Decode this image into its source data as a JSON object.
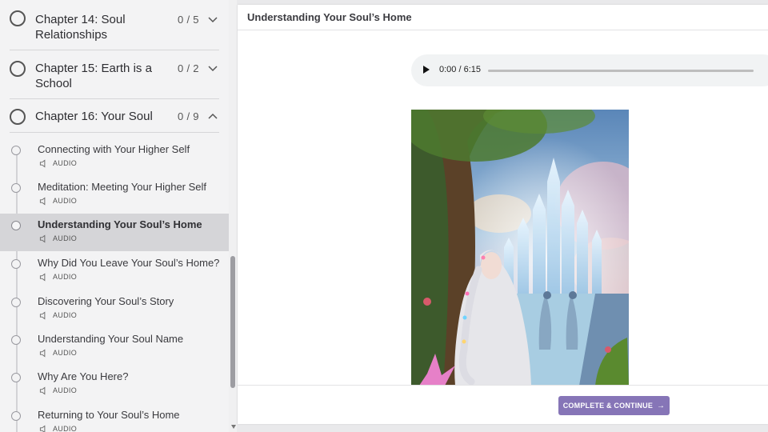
{
  "chapters": [
    {
      "title": "Chapter 14: Soul Relationships",
      "count": "0 / 5"
    },
    {
      "title": "Chapter 15: Earth is a School",
      "count": "0 / 2"
    },
    {
      "title": "Chapter 16: Your Soul",
      "count": "0 / 9"
    }
  ],
  "lessons": [
    {
      "title": "Connecting with Your Higher Self",
      "type": "AUDIO"
    },
    {
      "title": "Meditation: Meeting Your Higher Self",
      "type": "AUDIO"
    },
    {
      "title": "Understanding Your Soul’s Home",
      "type": "AUDIO"
    },
    {
      "title": "Why Did You Leave Your Soul’s Home?",
      "type": "AUDIO"
    },
    {
      "title": "Discovering Your Soul’s Story",
      "type": "AUDIO"
    },
    {
      "title": "Understanding Your Soul Name",
      "type": "AUDIO"
    },
    {
      "title": "Why Are You Here?",
      "type": "AUDIO"
    },
    {
      "title": "Returning to Your Soul’s Home",
      "type": "AUDIO"
    }
  ],
  "main": {
    "lesson_title": "Understanding Your Soul’s Home",
    "audio_time": "0:00 / 6:15",
    "image_subject": "illustration of a woman with braided hair beneath a tree looking at a crystal city",
    "complete_label": "COMPLETE & CONTINUE",
    "complete_arrow": "→"
  },
  "colors": {
    "accent": "#8675b7",
    "active_lesson_bg": "#d5d5d8"
  }
}
